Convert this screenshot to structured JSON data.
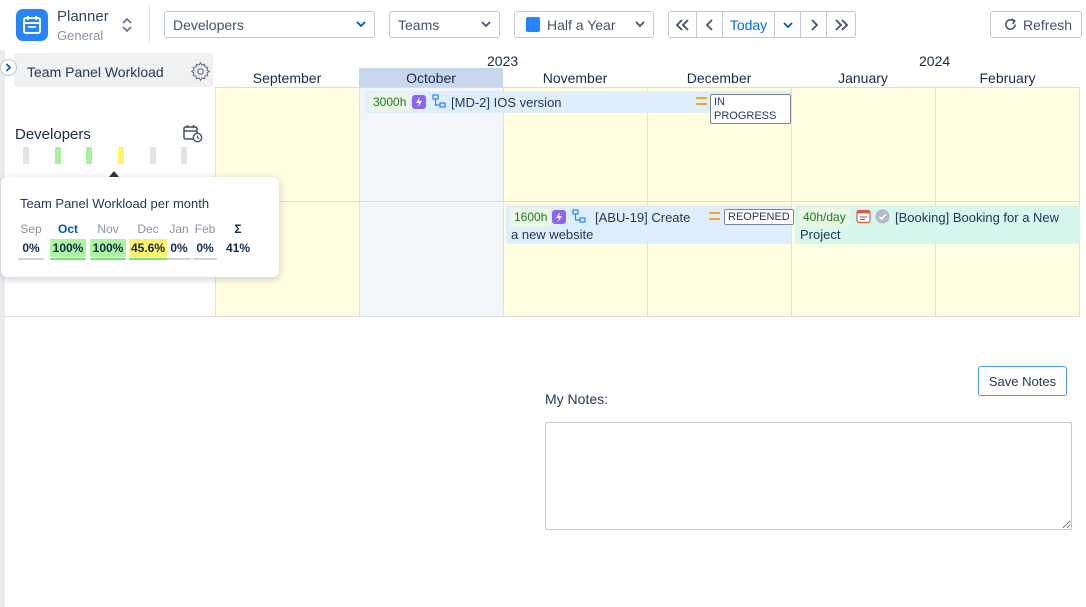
{
  "app": {
    "title": "Planner",
    "subtitle": "General"
  },
  "toolbar": {
    "resource_select": "Developers",
    "group_select": "Teams",
    "period_select": "Half a Year",
    "today_label": "Today",
    "refresh_label": "Refresh"
  },
  "panel": {
    "title": "Team Panel Workload"
  },
  "timeline": {
    "years": [
      "2023",
      "2024"
    ],
    "months": [
      "September",
      "October",
      "November",
      "December",
      "January",
      "February"
    ],
    "current_month": "October"
  },
  "team": {
    "name": "Developers",
    "workload_levels": [
      "none",
      "full",
      "full",
      "partial",
      "none",
      "none"
    ],
    "level_colors": {
      "none": "#e2e4e9",
      "full": "#a6f29b",
      "partial": "#fff36b"
    }
  },
  "tasks": [
    {
      "hours": "3000h",
      "key_title": "[MD-2] IOS version",
      "status": "IN PROGRESS"
    },
    {
      "hours": "1600h",
      "key_title": "[ABU-19] Create a new website",
      "status": "REOPENED"
    },
    {
      "hours": "40h/day",
      "key_title": "[Booking] Booking for a New Project",
      "status": ""
    }
  ],
  "tooltip": {
    "title": "Team Panel Workload per month",
    "months": [
      {
        "label": "Sep",
        "value": "0%",
        "level": "none"
      },
      {
        "label": "Oct",
        "value": "100%",
        "level": "full"
      },
      {
        "label": "Nov",
        "value": "100%",
        "level": "full"
      },
      {
        "label": "Dec",
        "value": "45.6%",
        "level": "partial"
      },
      {
        "label": "Jan",
        "value": "0%",
        "level": "none"
      },
      {
        "label": "Feb",
        "value": "0%",
        "level": "none"
      }
    ],
    "total_symbol": "Σ",
    "total_value": "41%"
  },
  "notes": {
    "label": "My Notes:",
    "save_label": "Save Notes",
    "value": ""
  }
}
